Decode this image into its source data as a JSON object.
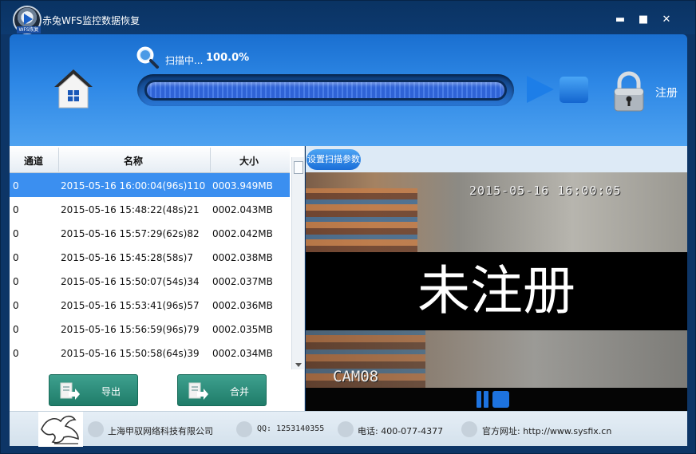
{
  "window": {
    "title": "赤兔WFS监控数据恢复",
    "logo_badge": "WFS恢复",
    "minimize": "▬",
    "maximize": "■",
    "close": "✕"
  },
  "header": {
    "scan_status": "扫描中...",
    "scan_percent": "100.0%",
    "progress": 1.0,
    "register_label": "注册"
  },
  "table": {
    "columns": [
      "通道",
      "名称",
      "大小"
    ],
    "rows": [
      {
        "channel": "0",
        "name": "2015-05-16 16:00:04(96s)110",
        "size": "0003.949MB",
        "selected": true
      },
      {
        "channel": "0",
        "name": "2015-05-16 15:48:22(48s)21",
        "size": "0002.043MB",
        "selected": false
      },
      {
        "channel": "0",
        "name": "2015-05-16 15:57:29(62s)82",
        "size": "0002.042MB",
        "selected": false
      },
      {
        "channel": "0",
        "name": "2015-05-16 15:45:28(58s)7",
        "size": "0002.038MB",
        "selected": false
      },
      {
        "channel": "0",
        "name": "2015-05-16 15:50:07(54s)34",
        "size": "0002.037MB",
        "selected": false
      },
      {
        "channel": "0",
        "name": "2015-05-16 15:53:41(96s)57",
        "size": "0002.036MB",
        "selected": false
      },
      {
        "channel": "0",
        "name": "2015-05-16 15:56:59(96s)79",
        "size": "0002.035MB",
        "selected": false
      },
      {
        "channel": "0",
        "name": "2015-05-16 15:50:58(64s)39",
        "size": "0002.034MB",
        "selected": false
      }
    ]
  },
  "actions": {
    "export_label": "导出",
    "merge_label": "合并"
  },
  "video": {
    "settings_button": "设置扫描参数",
    "timestamp": "2015-05-16 16:00:05",
    "watermark": "未注册",
    "camera": "CAM08"
  },
  "footer": {
    "company": "上海甲驭网络科技有限公司",
    "qq": "QQ: 1253140355",
    "phone": "电话: 400-077-4377",
    "website": "官方网址: http://www.sysfix.cn"
  },
  "colors": {
    "header_blue": "#2e88e6",
    "selected_row": "#3b8ff0",
    "action_green": "#2a8c78",
    "title_bar": "#0d3566"
  },
  "icons": [
    "home-icon",
    "search-icon",
    "play-icon",
    "stop-icon",
    "lock-icon",
    "export-icon",
    "merge-icon",
    "pause-icon",
    "company-icon",
    "qq-icon",
    "phone-icon",
    "globe-icon"
  ]
}
